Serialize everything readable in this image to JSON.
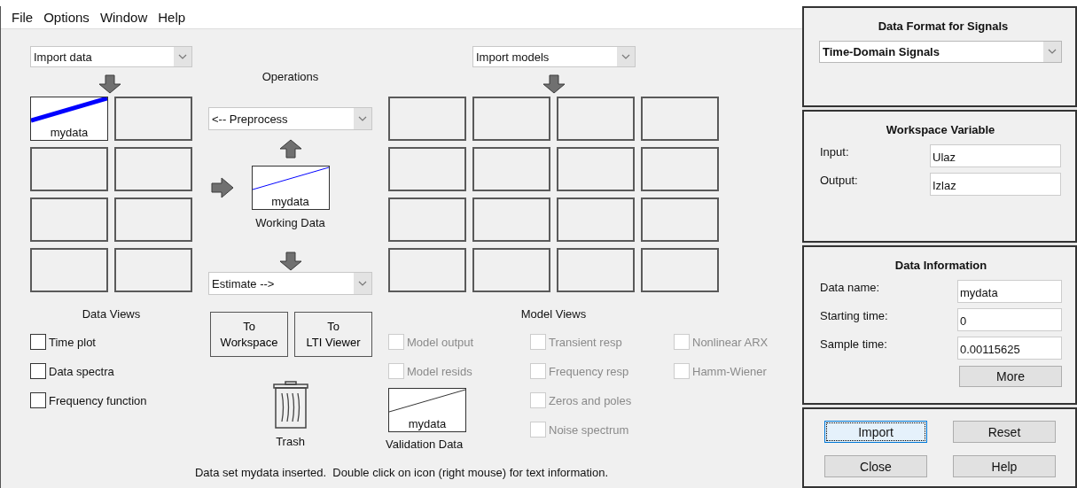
{
  "menu": [
    "File",
    "Options",
    "Window",
    "Help"
  ],
  "data_board": {
    "dropdown": "Import data",
    "slots": [
      {
        "kind": "data",
        "label": "mydata"
      },
      {
        "kind": "empty"
      },
      {
        "kind": "empty"
      },
      {
        "kind": "empty"
      },
      {
        "kind": "empty"
      },
      {
        "kind": "empty"
      },
      {
        "kind": "empty"
      },
      {
        "kind": "empty"
      }
    ]
  },
  "data_views": {
    "title": "Data Views",
    "options": [
      {
        "label": "Time plot",
        "checked": false,
        "disabled": false
      },
      {
        "label": "Data spectra",
        "checked": false,
        "disabled": false
      },
      {
        "label": "Frequency function",
        "checked": false,
        "disabled": false
      }
    ]
  },
  "operations": {
    "title": "Operations",
    "preprocess": "<-- Preprocess",
    "working_data": {
      "label": "mydata",
      "caption": "Working Data"
    },
    "estimate": "Estimate -->",
    "buttons": [
      "To\nWorkspace",
      "To\nLTI Viewer"
    ],
    "trash": "Trash"
  },
  "model_board": {
    "dropdown": "Import models",
    "slots": [
      {
        "kind": "empty"
      },
      {
        "kind": "empty"
      },
      {
        "kind": "empty"
      },
      {
        "kind": "empty"
      },
      {
        "kind": "empty"
      },
      {
        "kind": "empty"
      },
      {
        "kind": "empty"
      },
      {
        "kind": "empty"
      },
      {
        "kind": "empty"
      },
      {
        "kind": "empty"
      },
      {
        "kind": "empty"
      },
      {
        "kind": "empty"
      },
      {
        "kind": "empty"
      },
      {
        "kind": "empty"
      },
      {
        "kind": "empty"
      },
      {
        "kind": "empty"
      }
    ]
  },
  "model_views": {
    "title": "Model Views",
    "columns": [
      [
        {
          "label": "Model output",
          "checked": false,
          "disabled": true
        },
        {
          "label": "Model resids",
          "checked": false,
          "disabled": true
        }
      ],
      [
        {
          "label": "Transient resp",
          "checked": false,
          "disabled": true
        },
        {
          "label": "Frequency resp",
          "checked": false,
          "disabled": true
        },
        {
          "label": "Zeros and poles",
          "checked": false,
          "disabled": true
        },
        {
          "label": "Noise spectrum",
          "checked": false,
          "disabled": true
        }
      ],
      [
        {
          "label": "Nonlinear ARX",
          "checked": false,
          "disabled": true
        },
        {
          "label": "Hamm-Wiener",
          "checked": false,
          "disabled": true
        }
      ]
    ]
  },
  "validation_data": {
    "label": "mydata",
    "caption": "Validation Data"
  },
  "status": "Data set mydata inserted.  Double click on icon (right mouse) for text information.",
  "data_format": {
    "title": "Data Format for Signals",
    "value": "Time-Domain Signals"
  },
  "workspace_variable": {
    "title": "Workspace Variable",
    "fields": [
      {
        "label": "Input:",
        "value": "Ulaz"
      },
      {
        "label": "Output:",
        "value": "Izlaz"
      }
    ]
  },
  "data_information": {
    "title": "Data Information",
    "fields": [
      {
        "label": "Data name:",
        "value": "mydata"
      },
      {
        "label": "Starting time:",
        "value": "0"
      },
      {
        "label": "Sample time:",
        "value": "0.00115625"
      }
    ],
    "more_button": "More"
  },
  "actions": [
    {
      "label": "Import",
      "focused": true
    },
    {
      "label": "Reset",
      "focused": false
    },
    {
      "label": "Close",
      "focused": false
    },
    {
      "label": "Help",
      "focused": false
    }
  ]
}
